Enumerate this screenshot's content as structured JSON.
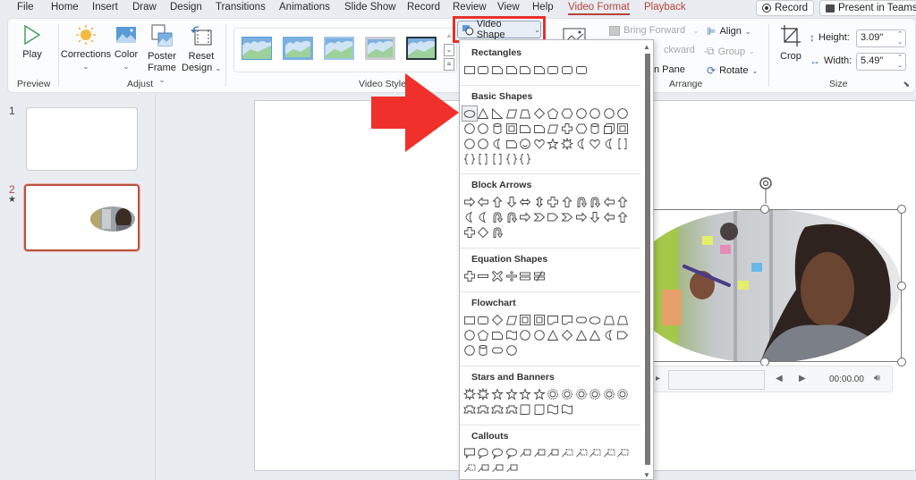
{
  "tabs": [
    {
      "label": "File"
    },
    {
      "label": "Home"
    },
    {
      "label": "Insert"
    },
    {
      "label": "Draw"
    },
    {
      "label": "Design"
    },
    {
      "label": "Transitions"
    },
    {
      "label": "Animations"
    },
    {
      "label": "Slide Show"
    },
    {
      "label": "Record"
    },
    {
      "label": "Review"
    },
    {
      "label": "View"
    },
    {
      "label": "Help"
    },
    {
      "label": "Video Format"
    },
    {
      "label": "Playback"
    }
  ],
  "active_tab": "Video Format",
  "header_buttons": {
    "record": "Record",
    "present": "Present in Teams"
  },
  "ribbon": {
    "preview": {
      "play": "Play",
      "group": "Preview"
    },
    "adjust": {
      "corrections": "Corrections",
      "color": "Color",
      "poster_frame_1": "Poster",
      "poster_frame_2": "Frame",
      "reset_1": "Reset",
      "reset_2": "Design",
      "group": "Adjust"
    },
    "video_styles": {
      "group": "Video Styles",
      "video_shape": "Video Shape"
    },
    "arrange": {
      "bring_forward": "Bring Forward",
      "send_backward": "ckward",
      "selection_pane": "n Pane",
      "align": "Align",
      "group_btn": "Group",
      "rotate": "Rotate",
      "group": "Arrange"
    },
    "size": {
      "crop": "Crop",
      "height_label": "Height:",
      "height_value": "3.09\"",
      "width_label": "Width:",
      "width_value": "5.49\"",
      "group": "Size"
    }
  },
  "slides": [
    {
      "number": "1"
    },
    {
      "number": "2",
      "marker": "★"
    }
  ],
  "dropdown": {
    "sections": [
      {
        "title": "Rectangles"
      },
      {
        "title": "Basic Shapes"
      },
      {
        "title": "Block Arrows"
      },
      {
        "title": "Equation Shapes"
      },
      {
        "title": "Flowchart"
      },
      {
        "title": "Stars and Banners"
      },
      {
        "title": "Callouts"
      }
    ],
    "highlighted_shape": "Oval"
  },
  "video": {
    "time": "00:00.00"
  },
  "colors": {
    "accent": "#b8433a",
    "highlight_red": "#e8302c",
    "arrow_red": "#f0302a"
  }
}
